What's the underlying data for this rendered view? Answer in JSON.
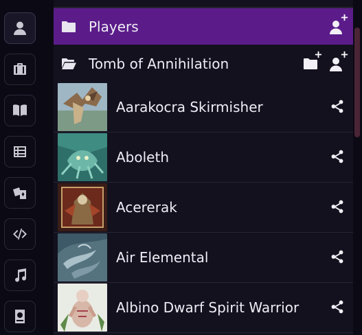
{
  "sidebar_tabs": [
    {
      "name": "actors",
      "icon": "user-icon",
      "active": true
    },
    {
      "name": "items",
      "icon": "briefcase-icon",
      "active": false
    },
    {
      "name": "journal",
      "icon": "book-open-icon",
      "active": false
    },
    {
      "name": "tables",
      "icon": "list-table-icon",
      "active": false
    },
    {
      "name": "cards",
      "icon": "cards-icon",
      "active": false
    },
    {
      "name": "macros",
      "icon": "code-icon",
      "active": false
    },
    {
      "name": "playlists",
      "icon": "music-icon",
      "active": false
    },
    {
      "name": "compendium",
      "icon": "atlas-icon",
      "active": false
    }
  ],
  "directory": {
    "folders": [
      {
        "label": "Players",
        "color": "#5b1c8a",
        "expanded": false
      },
      {
        "label": "Tomb of Annihilation",
        "color": "#13111e",
        "expanded": true
      }
    ],
    "entries": [
      {
        "name": "Aarakocra Skirmisher"
      },
      {
        "name": "Aboleth"
      },
      {
        "name": "Acererak"
      },
      {
        "name": "Air Elemental"
      },
      {
        "name": "Albino Dwarf Spirit Warrior"
      }
    ]
  },
  "colors": {
    "background": "#0b0a14",
    "panel": "#13111e",
    "players_folder": "#5b1c8a",
    "text": "#efedf4"
  }
}
